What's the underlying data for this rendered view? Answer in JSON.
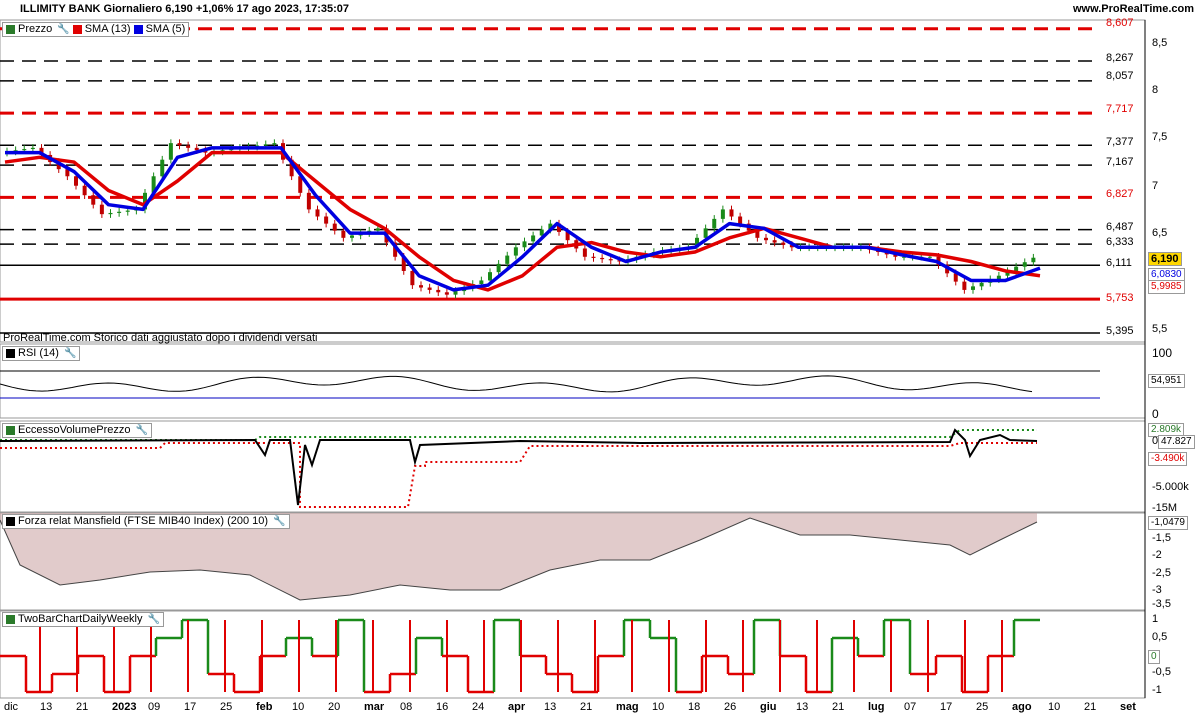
{
  "header": {
    "title": "ILLIMITY BANK Giornaliero 6,190 +1,06% 17 ago 2023, 17:35:07",
    "site": "www.ProRealTime.com"
  },
  "price_panel": {
    "legend": [
      {
        "label": "Prezzo",
        "color": "#2a7a2a"
      },
      {
        "label": "SMA (13)",
        "color": "#e00000"
      },
      {
        "label": "SMA (5)",
        "color": "#0000e0"
      }
    ],
    "note": "ProRealTime.com Storico dati aggiustato dopo i dividendi versati",
    "right_axis_ticks": [
      "8,5",
      "8",
      "7,5",
      "7",
      "6,5",
      "6",
      "5,5"
    ],
    "level_labels": [
      {
        "text": "8,607",
        "color": "#e00000"
      },
      {
        "text": "8,267",
        "color": "#000000"
      },
      {
        "text": "8,057",
        "color": "#000000"
      },
      {
        "text": "7,717",
        "color": "#e00000"
      },
      {
        "text": "7,377",
        "color": "#000000"
      },
      {
        "text": "7,167",
        "color": "#000000"
      },
      {
        "text": "6,827",
        "color": "#e00000"
      },
      {
        "text": "6,487",
        "color": "#000000"
      },
      {
        "text": "6,333",
        "color": "#000000"
      },
      {
        "text": "6,111",
        "color": "#000000"
      },
      {
        "text": "5,753",
        "color": "#e00000"
      },
      {
        "text": "5,395",
        "color": "#000000"
      }
    ],
    "last_price": "6,190",
    "sma5_value": "6,0830",
    "sma13_value": "5,9985"
  },
  "rsi_panel": {
    "legend": "RSI (14)",
    "ticks": [
      "100",
      "0"
    ],
    "value": "54,951"
  },
  "volume_panel": {
    "legend": "EccessoVolumePrezzo",
    "ticks": [
      "0",
      "-5.000k",
      "-15M"
    ],
    "upper_value": "2.809k",
    "value": "47.827",
    "lower_value": "-3.490k"
  },
  "mansfield_panel": {
    "legend": "Forza relat Mansfield (FTSE MIB40 Index) (200 10)",
    "ticks": [
      "-1,5",
      "-2",
      "-2,5",
      "-3",
      "-3,5"
    ],
    "value": "-1,0479"
  },
  "twobar_panel": {
    "legend": "TwoBarChartDailyWeekly",
    "ticks": [
      "1",
      "0,5",
      "0",
      "-0,5",
      "-1"
    ],
    "value": "0"
  },
  "x_axis": [
    "dic",
    "13",
    "21",
    "2023",
    "09",
    "17",
    "25",
    "feb",
    "10",
    "20",
    "mar",
    "08",
    "16",
    "24",
    "apr",
    "13",
    "21",
    "mag",
    "10",
    "18",
    "26",
    "giu",
    "13",
    "21",
    "lug",
    "07",
    "17",
    "25",
    "ago",
    "10",
    "21",
    "set"
  ],
  "chart_data": {
    "type": "line",
    "title": "ILLIMITY BANK Giornaliero",
    "x": [
      "dic",
      "13",
      "21",
      "2023",
      "09",
      "17",
      "25",
      "feb",
      "10",
      "20",
      "mar",
      "08",
      "16",
      "24",
      "apr",
      "13",
      "21",
      "mag",
      "10",
      "18",
      "26",
      "giu",
      "13",
      "21",
      "lug",
      "07",
      "17",
      "25",
      "ago",
      "10",
      "21",
      "set"
    ],
    "ylim": [
      5.3,
      8.7
    ],
    "series": [
      {
        "name": "Prezzo",
        "values": [
          7.3,
          7.35,
          7.05,
          6.65,
          6.7,
          7.4,
          7.3,
          7.35,
          7.4,
          6.7,
          6.4,
          6.5,
          5.9,
          5.8,
          5.95,
          6.3,
          6.55,
          6.2,
          6.15,
          6.25,
          6.3,
          6.7,
          6.4,
          6.3,
          6.3,
          6.3,
          6.2,
          6.2,
          5.85,
          6.0,
          6.19
        ]
      },
      {
        "name": "SMA (13)",
        "values": [
          7.2,
          7.25,
          7.2,
          6.9,
          6.75,
          7.0,
          7.3,
          7.3,
          7.3,
          7.0,
          6.7,
          6.5,
          6.2,
          5.95,
          5.85,
          6.0,
          6.3,
          6.35,
          6.25,
          6.2,
          6.25,
          6.4,
          6.5,
          6.4,
          6.3,
          6.3,
          6.25,
          6.22,
          6.15,
          6.05,
          6.0
        ]
      },
      {
        "name": "SMA (5)",
        "values": [
          7.3,
          7.3,
          7.1,
          6.75,
          6.7,
          7.25,
          7.35,
          7.35,
          7.35,
          6.85,
          6.45,
          6.45,
          6.0,
          5.85,
          5.9,
          6.2,
          6.55,
          6.3,
          6.15,
          6.25,
          6.3,
          6.55,
          6.5,
          6.3,
          6.3,
          6.3,
          6.22,
          6.15,
          5.95,
          5.95,
          6.08
        ]
      }
    ],
    "levels": [
      8.607,
      8.267,
      8.057,
      7.717,
      7.377,
      7.167,
      6.827,
      6.487,
      6.333,
      6.111,
      5.753,
      5.395
    ]
  }
}
